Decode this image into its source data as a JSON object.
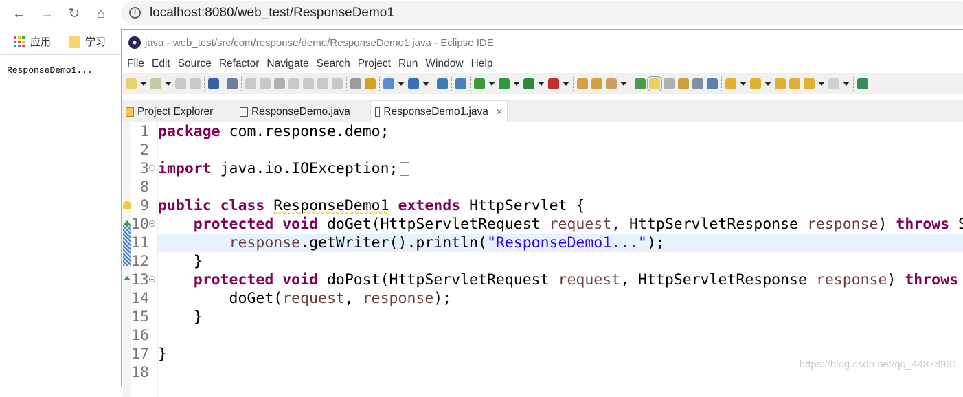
{
  "browser": {
    "url": "localhost:8080/web_test/ResponseDemo1",
    "bookmarks": [
      {
        "label": "应用",
        "icon": "apps-icon"
      },
      {
        "label": "学习",
        "icon": "folder-icon"
      }
    ],
    "page_text": "ResponseDemo1..."
  },
  "eclipse": {
    "title": "java - web_test/src/com/response/demo/ResponseDemo1.java - Eclipse IDE",
    "menu": [
      "File",
      "Edit",
      "Source",
      "Refactor",
      "Navigate",
      "Search",
      "Project",
      "Run",
      "Window",
      "Help"
    ],
    "toolbar": [
      {
        "icon": "new-icon",
        "color": "#e8d06a",
        "drop": true
      },
      {
        "icon": "new-class-icon",
        "color": "#c8c8a0",
        "drop": true
      },
      {
        "icon": "save-icon",
        "color": "#c8c8c8"
      },
      {
        "icon": "save-all-icon",
        "color": "#c8c8c8"
      },
      "sep",
      {
        "icon": "terminal-icon",
        "color": "#3a5fa8"
      },
      "sep",
      {
        "icon": "skip-breakpoints-icon",
        "color": "#6a7fa0"
      },
      "sep",
      {
        "icon": "resume-icon",
        "color": "#c8c8c8"
      },
      {
        "icon": "suspend-icon",
        "color": "#c8c8c8"
      },
      {
        "icon": "terminate-icon",
        "color": "#b0b0b0"
      },
      {
        "icon": "disconnect-icon",
        "color": "#c8c8c8"
      },
      {
        "icon": "step-into-icon",
        "color": "#c8c8c8"
      },
      {
        "icon": "step-over-icon",
        "color": "#c8c8c8"
      },
      {
        "icon": "step-return-icon",
        "color": "#c8c8c8"
      },
      "sep",
      {
        "icon": "drop-to-frame-icon",
        "color": "#9a9a9a"
      },
      {
        "icon": "use-step-filters-icon",
        "color": "#d4a020"
      },
      "sep",
      {
        "icon": "new-server-icon",
        "color": "#5a8ad0",
        "drop": true
      },
      {
        "icon": "new-servlet-icon",
        "color": "#3a6fc0",
        "drop": true
      },
      "sep",
      {
        "icon": "globe-icon",
        "color": "#3a7fb0"
      },
      "sep",
      {
        "icon": "publish-icon",
        "color": "#4a7fc0"
      },
      "sep",
      {
        "icon": "debug-icon",
        "color": "#3a9a3a",
        "drop": true
      },
      {
        "icon": "run-icon",
        "color": "#2a9a3a",
        "drop": true
      },
      {
        "icon": "coverage-icon",
        "color": "#2a8a3a",
        "drop": true
      },
      {
        "icon": "external-tools-icon",
        "color": "#c03030",
        "drop": true
      },
      "sep",
      {
        "icon": "open-type-icon",
        "color": "#d4a040"
      },
      {
        "icon": "open-folder-icon",
        "color": "#d4a040"
      },
      {
        "icon": "search-pen-icon",
        "color": "#c8a060",
        "drop": true
      },
      "sep",
      {
        "icon": "annotation-icon",
        "color": "#4a9a4a"
      },
      {
        "icon": "mark-occurrences-icon",
        "color": "#e8d060",
        "active": true
      },
      {
        "icon": "breadcrumb-icon",
        "color": "#b0b0b0"
      },
      {
        "icon": "block-selection-icon",
        "color": "#c8a040"
      },
      {
        "icon": "word-wrap-icon",
        "color": "#8090a0"
      },
      {
        "icon": "show-whitespace-icon",
        "color": "#5a80b0"
      },
      "sep",
      {
        "icon": "next-annotation-icon",
        "color": "#e0b030",
        "drop": true
      },
      {
        "icon": "previous-annotation-icon",
        "color": "#e0b030",
        "drop": true
      },
      {
        "icon": "last-edit-icon",
        "color": "#e0b030"
      },
      {
        "icon": "forward-edit-icon",
        "color": "#e0b030"
      },
      {
        "icon": "back-icon",
        "color": "#e0b030",
        "drop": true
      },
      {
        "icon": "forward-icon",
        "color": "#d0d0d0",
        "drop": true
      },
      "sep",
      {
        "icon": "open-perspective-icon",
        "color": "#3a8a5a"
      }
    ],
    "tabs": [
      {
        "label": "Project Explorer",
        "icon": "project-explorer-icon",
        "active": false
      },
      {
        "label": "ResponseDemo.java",
        "icon": "java-file-icon",
        "active": false
      },
      {
        "label": "ResponseDemo1.java",
        "icon": "java-file-icon",
        "active": true,
        "close": "✕"
      }
    ],
    "code": [
      {
        "n": "1",
        "t": [
          [
            "kw",
            "package"
          ],
          [
            "pl",
            " com.response.demo;"
          ]
        ]
      },
      {
        "n": "2",
        "t": []
      },
      {
        "n": "3",
        "fold": "+",
        "collapsed": true,
        "t": [
          [
            "kw",
            "import"
          ],
          [
            "pl",
            " java.io.IOException;"
          ]
        ]
      },
      {
        "n": "8",
        "t": []
      },
      {
        "n": "9",
        "marker": "warning-bulb",
        "t": [
          [
            "kw",
            "public class"
          ],
          [
            "pl",
            " "
          ],
          [
            "sq",
            "ResponseDemo1"
          ],
          [
            "pl",
            " "
          ],
          [
            "kw",
            "extends"
          ],
          [
            "pl",
            " HttpServlet {"
          ]
        ]
      },
      {
        "n": "10",
        "fold": "−",
        "marker": "override",
        "t": [
          [
            "pl",
            "    "
          ],
          [
            "kw",
            "protected void"
          ],
          [
            "pl",
            " doGet(HttpServletRequest "
          ],
          [
            "pm",
            "request"
          ],
          [
            "pl",
            ", HttpServletResponse "
          ],
          [
            "pm",
            "response"
          ],
          [
            "pl",
            ") "
          ],
          [
            "kw",
            "throws"
          ],
          [
            "pl",
            " S"
          ]
        ]
      },
      {
        "n": "11",
        "current": true,
        "t": [
          [
            "pl",
            "        "
          ],
          [
            "pm",
            "response"
          ],
          [
            "pl",
            ".getWriter().println("
          ],
          [
            "st",
            "\"ResponseDemo1...\""
          ],
          [
            "pl",
            ");"
          ]
        ]
      },
      {
        "n": "12",
        "t": [
          [
            "pl",
            "    }"
          ]
        ]
      },
      {
        "n": "13",
        "fold": "−",
        "marker": "override",
        "t": [
          [
            "pl",
            "    "
          ],
          [
            "kw",
            "protected void"
          ],
          [
            "pl",
            " doPost(HttpServletRequest "
          ],
          [
            "pm",
            "request"
          ],
          [
            "pl",
            ", HttpServletResponse "
          ],
          [
            "pm",
            "response"
          ],
          [
            "pl",
            ") "
          ],
          [
            "kw",
            "throws"
          ]
        ]
      },
      {
        "n": "14",
        "t": [
          [
            "pl",
            "        doGet("
          ],
          [
            "pm",
            "request"
          ],
          [
            "pl",
            ", "
          ],
          [
            "pm",
            "response"
          ],
          [
            "pl",
            ");"
          ]
        ]
      },
      {
        "n": "15",
        "t": [
          [
            "pl",
            "    }"
          ]
        ]
      },
      {
        "n": "16",
        "t": []
      },
      {
        "n": "17",
        "t": [
          [
            "pl",
            "}"
          ]
        ]
      },
      {
        "n": "18",
        "t": []
      }
    ]
  },
  "watermark": "https://blog.csdn.net/qq_44878991",
  "colors": {
    "keyword": "#7f0055",
    "parameter": "#6a3e3e",
    "string": "#2a00ff",
    "current_line": "#e8f2fe"
  }
}
